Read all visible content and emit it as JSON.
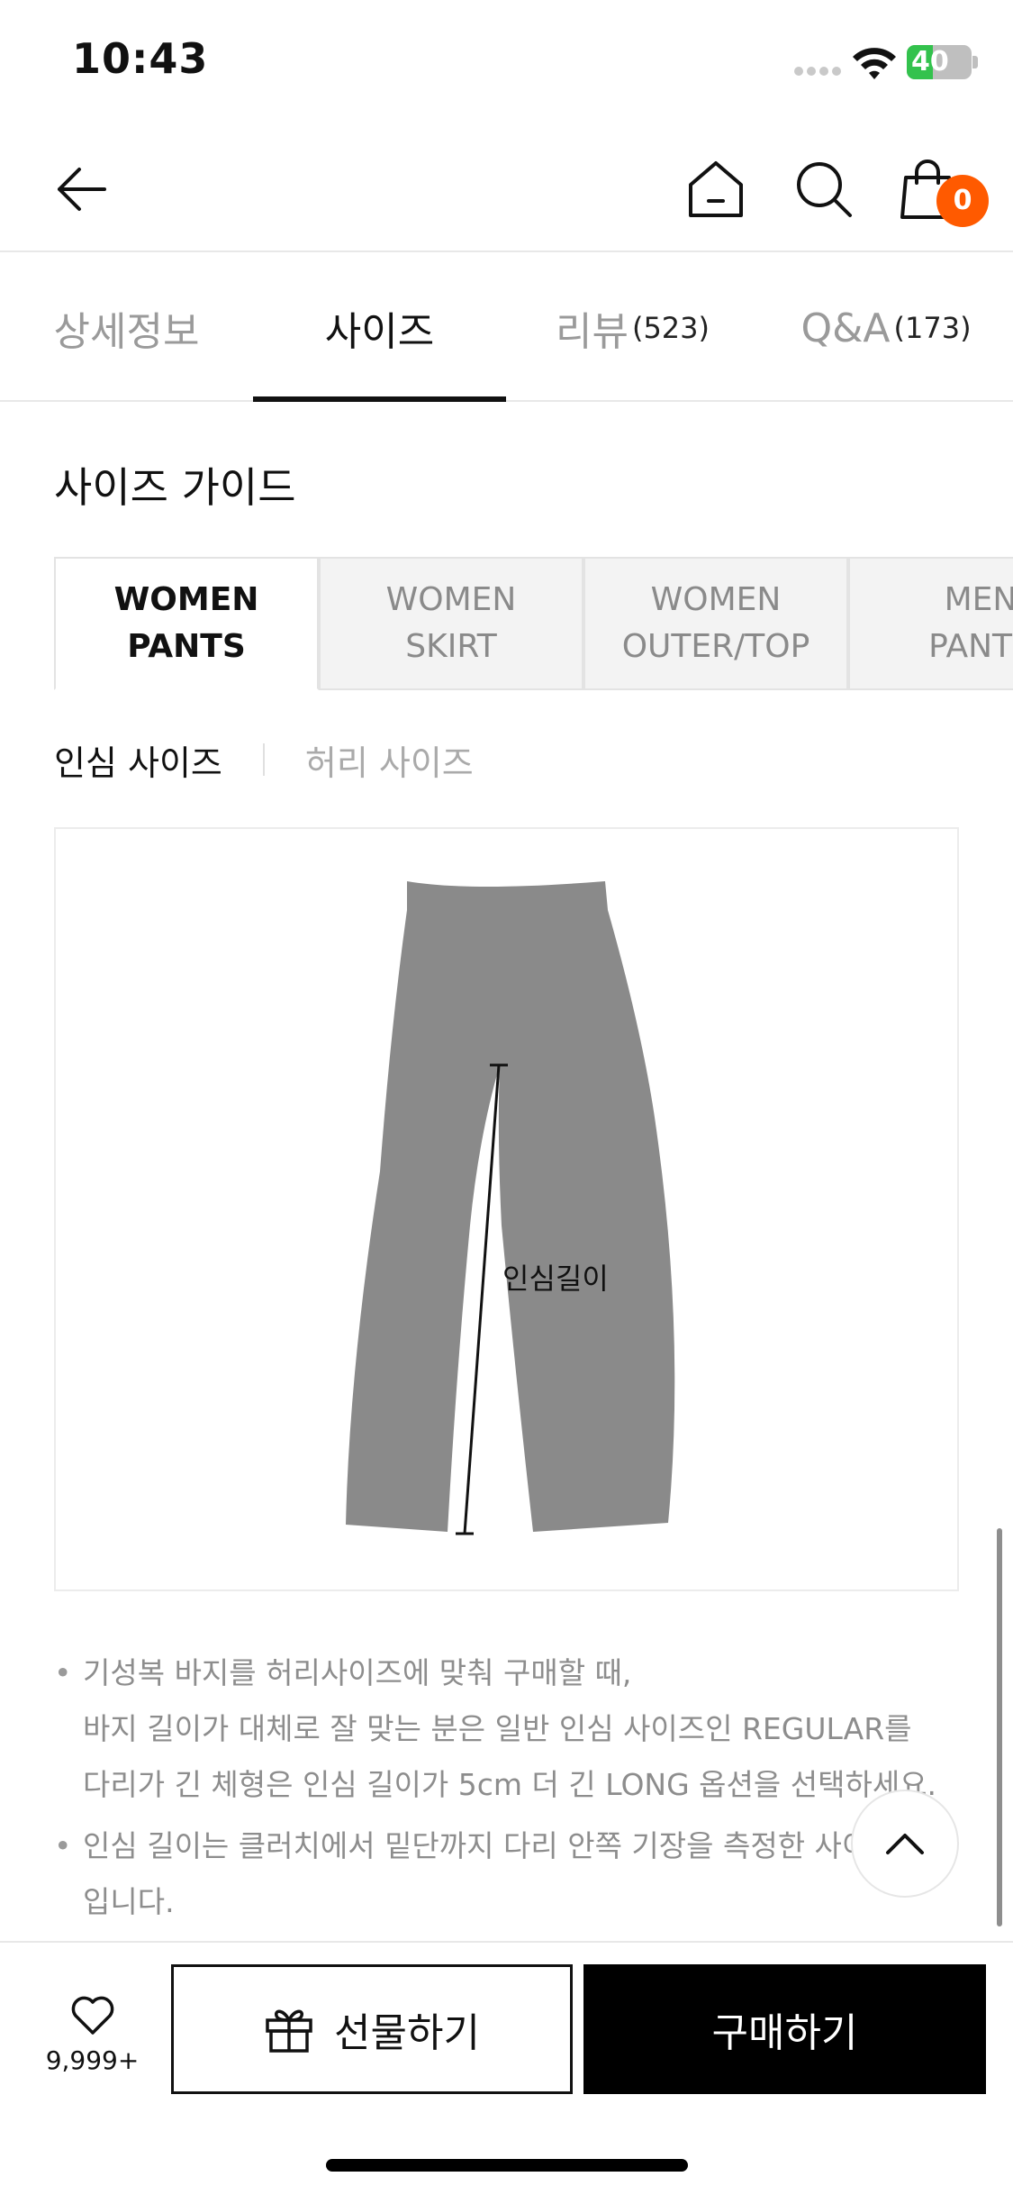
{
  "status_bar": {
    "time": "10:43",
    "battery_level": "40",
    "battery_fraction": 0.4
  },
  "header": {
    "cart_count": "0"
  },
  "tabs": [
    {
      "label": "상세정보",
      "count": ""
    },
    {
      "label": "사이즈",
      "count": ""
    },
    {
      "label": "리뷰",
      "count": "(523)"
    },
    {
      "label": "Q&A",
      "count": "(173)"
    }
  ],
  "size_guide": {
    "title": "사이즈 가이드",
    "categories": [
      {
        "line1": "WOMEN",
        "line2": "PANTS"
      },
      {
        "line1": "WOMEN",
        "line2": "SKIRT"
      },
      {
        "line1": "WOMEN",
        "line2": "OUTER/TOP"
      },
      {
        "line1": "MEN",
        "line2": "PANTS"
      }
    ],
    "sub_tabs": [
      "인심 사이즈",
      "허리 사이즈"
    ],
    "measure_label": "인심길이",
    "notes": [
      [
        "기성복 바지를 허리사이즈에 맞춰 구매할 때,",
        "바지 길이가 대체로 잘 맞는 분은 일반 인심 사이즈인 REGULAR를",
        "다리가 긴 체형은 인심 길이가 5cm 더 긴 LONG 옵션을 선택하세요."
      ],
      [
        "인심 길이는 클러치에서 밑단까지 다리 안쪽 기장을 측정한 사이즈",
        "입니다."
      ]
    ]
  },
  "bottom_bar": {
    "wish_count": "9,999+",
    "gift_label": "선물하기",
    "buy_label": "구매하기"
  },
  "icons": [
    "back-arrow-icon",
    "home-icon",
    "search-icon",
    "shopping-bag-icon",
    "heart-icon",
    "gift-icon",
    "chevron-up-icon"
  ]
}
